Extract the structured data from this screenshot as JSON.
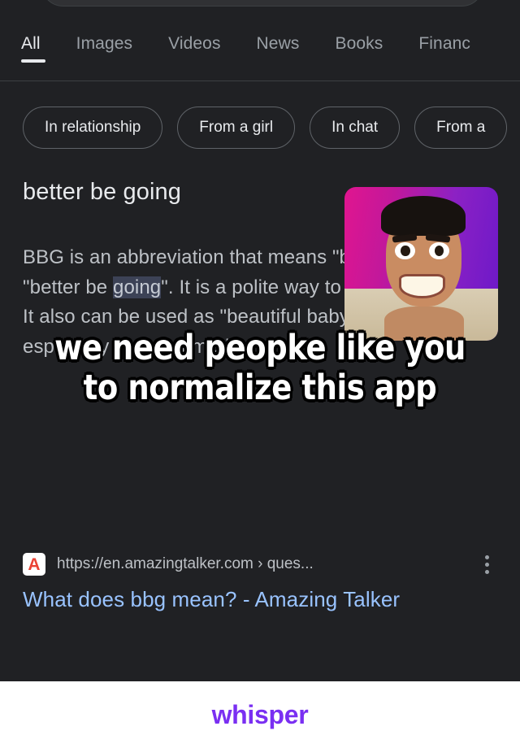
{
  "theme": {
    "background": "#202124",
    "text_primary": "#e8eaed",
    "text_secondary": "#bdc1c6",
    "link": "#99c3ff",
    "divider": "#3c4043",
    "watermark": "#7a2ff2",
    "favicon_red": "#ea4335"
  },
  "tabs": [
    {
      "label": "All",
      "active": true
    },
    {
      "label": "Images",
      "active": false
    },
    {
      "label": "Videos",
      "active": false
    },
    {
      "label": "News",
      "active": false
    },
    {
      "label": "Books",
      "active": false
    },
    {
      "label": "Financ",
      "active": false
    }
  ],
  "chips": [
    {
      "label": "In relationship"
    },
    {
      "label": "From a girl"
    },
    {
      "label": "In chat"
    },
    {
      "label": "From a"
    }
  ],
  "snippet": {
    "heading": "better be going",
    "body_part1": "BBG is an abbreviation that means \"baby girl\" or \"better be ",
    "body_selected": "going",
    "body_part2": "\".",
    "body_rest": "It is a polite way to end the chat. It also can be used as \"beautiful baby girl\", especially in social media."
  },
  "thumbnail": {
    "alt": "smiling man photo thumbnail",
    "gradient_start": "#e0158f",
    "gradient_end": "#6a18c9"
  },
  "caption": {
    "line1": "we need peopke like you",
    "line2": "to normalize this app"
  },
  "result": {
    "favicon_letter": "A",
    "url": "https://en.amazingtalker.com › ques...",
    "title": "What does bbg mean? - Amazing Talker",
    "menu_label": "More options"
  },
  "footer": {
    "watermark": "whisper"
  }
}
